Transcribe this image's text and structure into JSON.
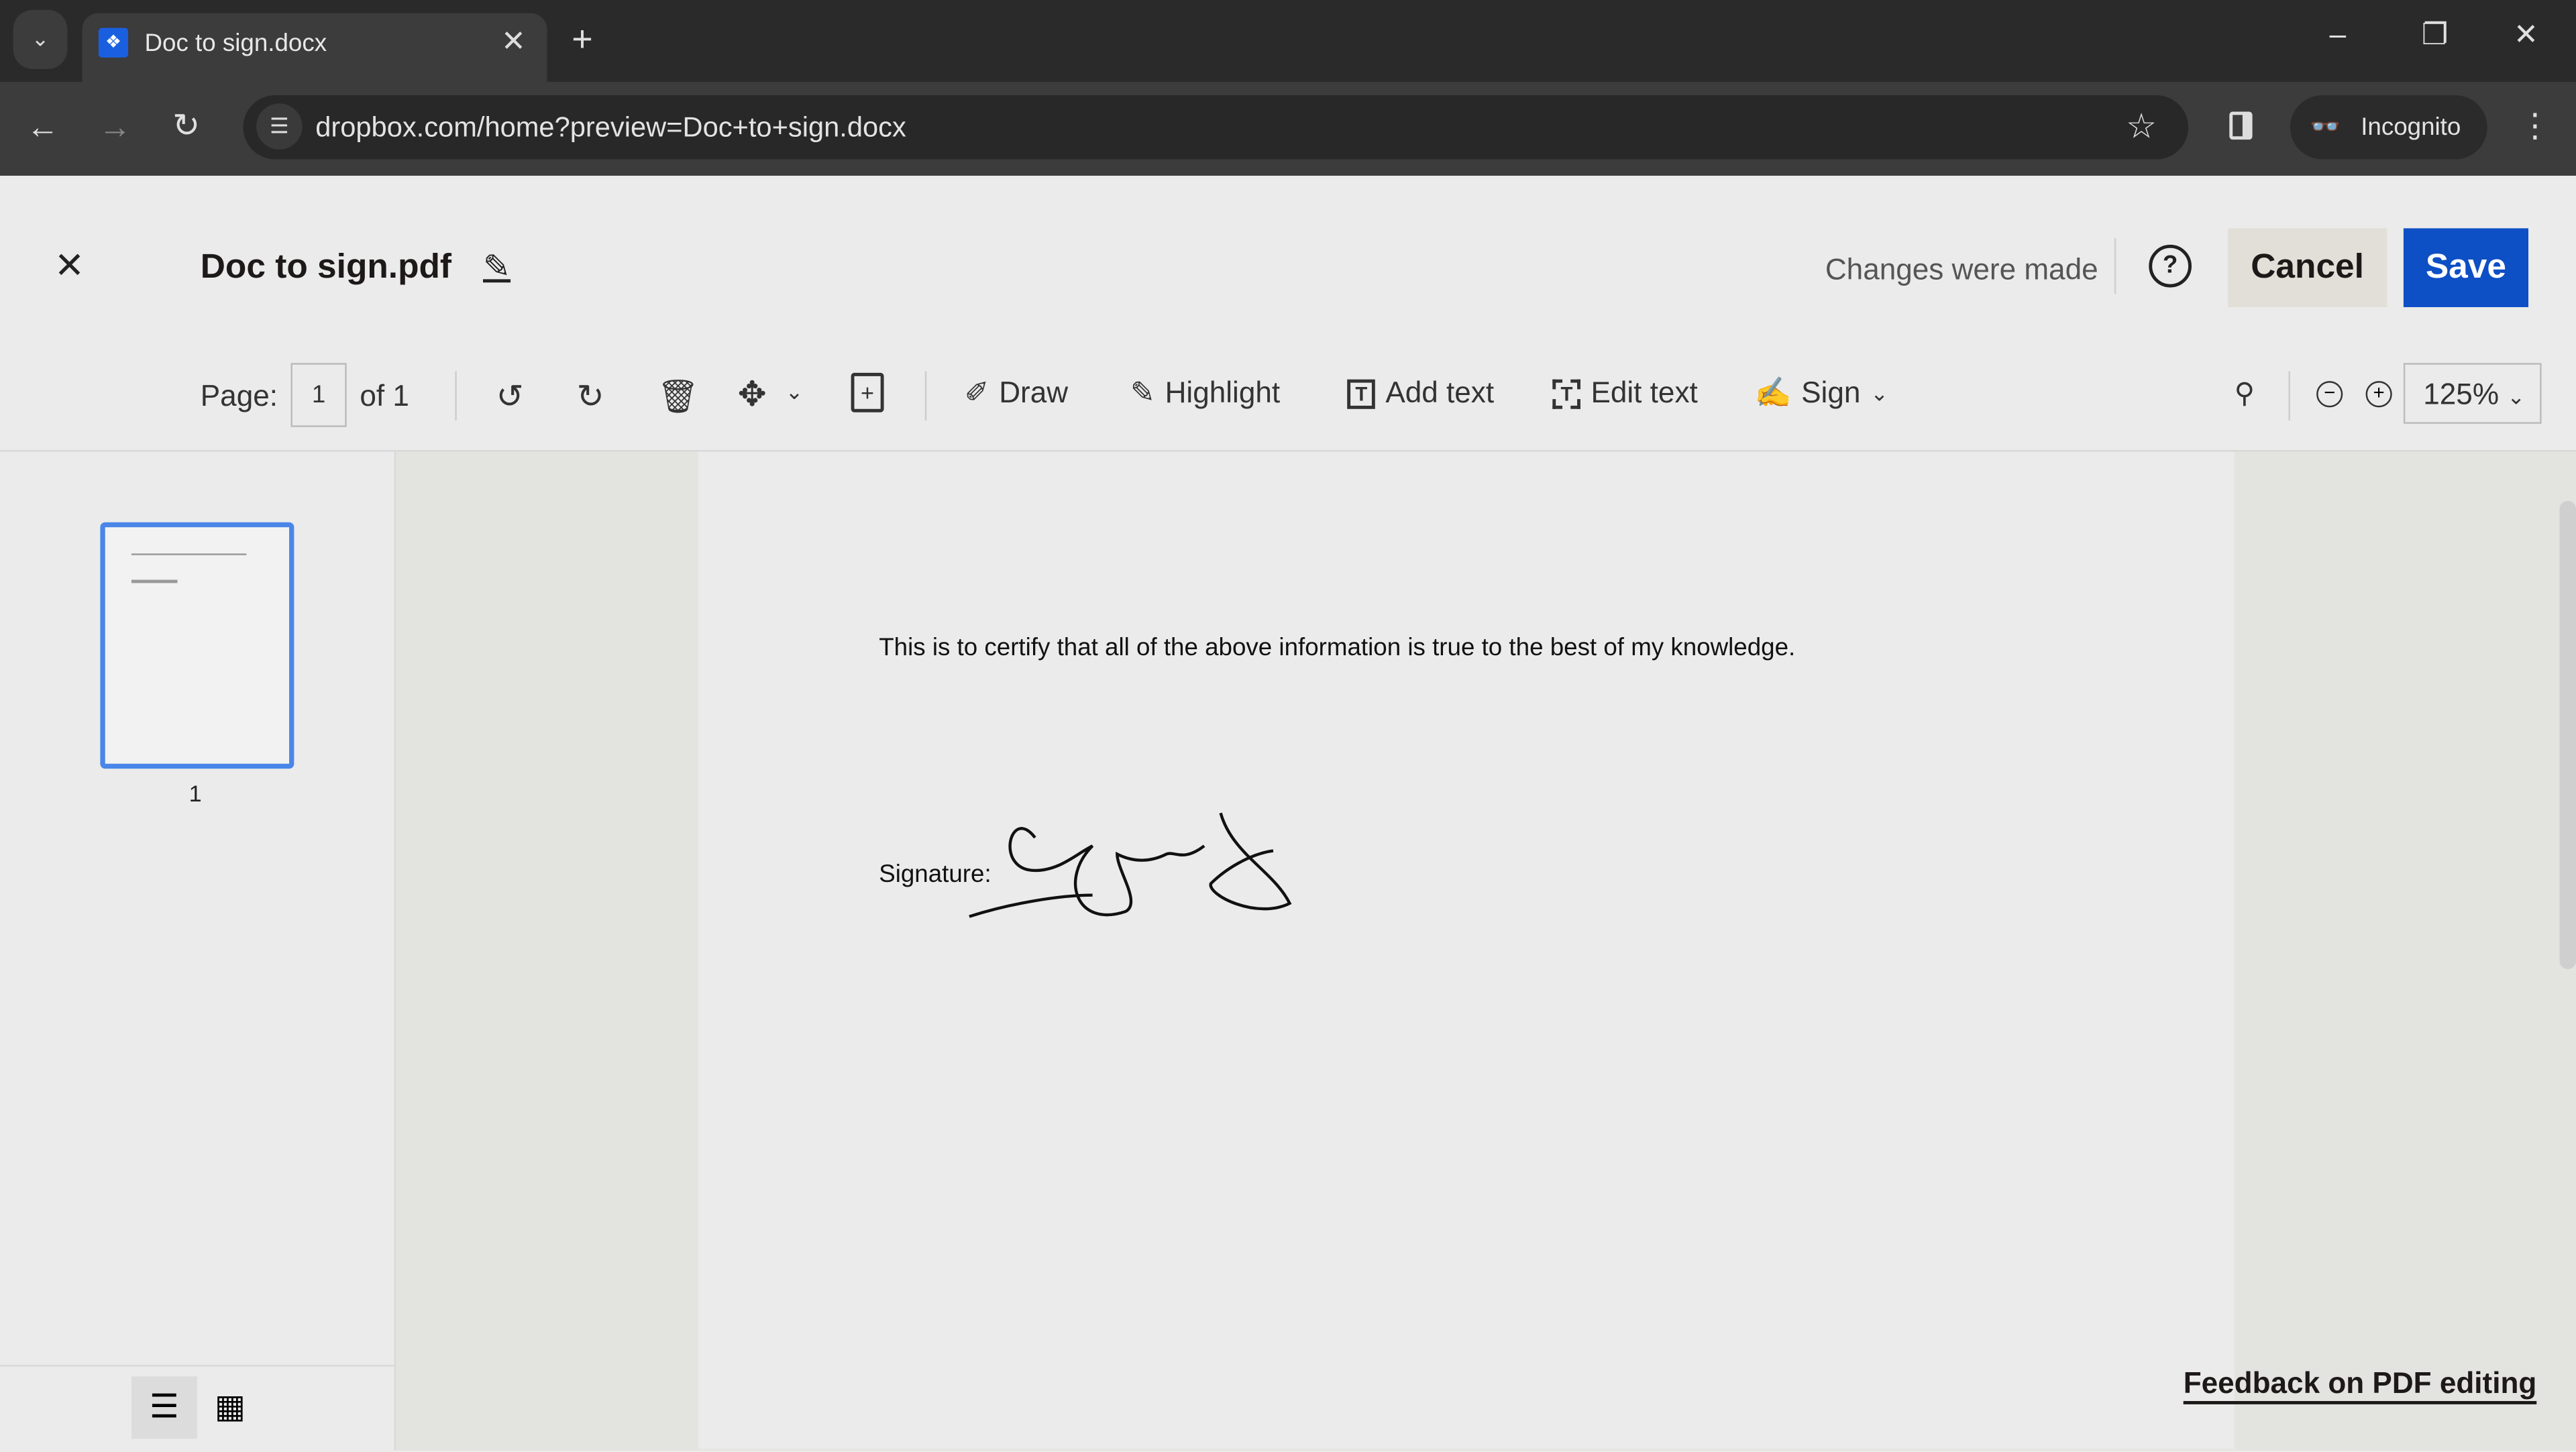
{
  "browser": {
    "tab_title": "Doc to sign.docx",
    "url": "dropbox.com/home?preview=Doc+to+sign.docx",
    "incognito_label": "Incognito"
  },
  "header": {
    "file_name": "Doc to sign.pdf",
    "status": "Changes were made",
    "cancel_label": "Cancel",
    "save_label": "Save",
    "save_color": "#0d4fc4"
  },
  "toolbar": {
    "page_label": "Page:",
    "page_value": "1",
    "page_of": "of 1",
    "draw": "Draw",
    "highlight": "Highlight",
    "add_text": "Add text",
    "edit_text": "Edit text",
    "sign": "Sign",
    "zoom": "125%"
  },
  "sidebar": {
    "thumbnails": [
      {
        "label": "1"
      }
    ]
  },
  "document": {
    "certify_text": "This is to certify that all of the above information is true to the best of my knowledge.",
    "signature_label": "Signature:"
  },
  "footer": {
    "feedback": "Feedback on PDF editing"
  }
}
